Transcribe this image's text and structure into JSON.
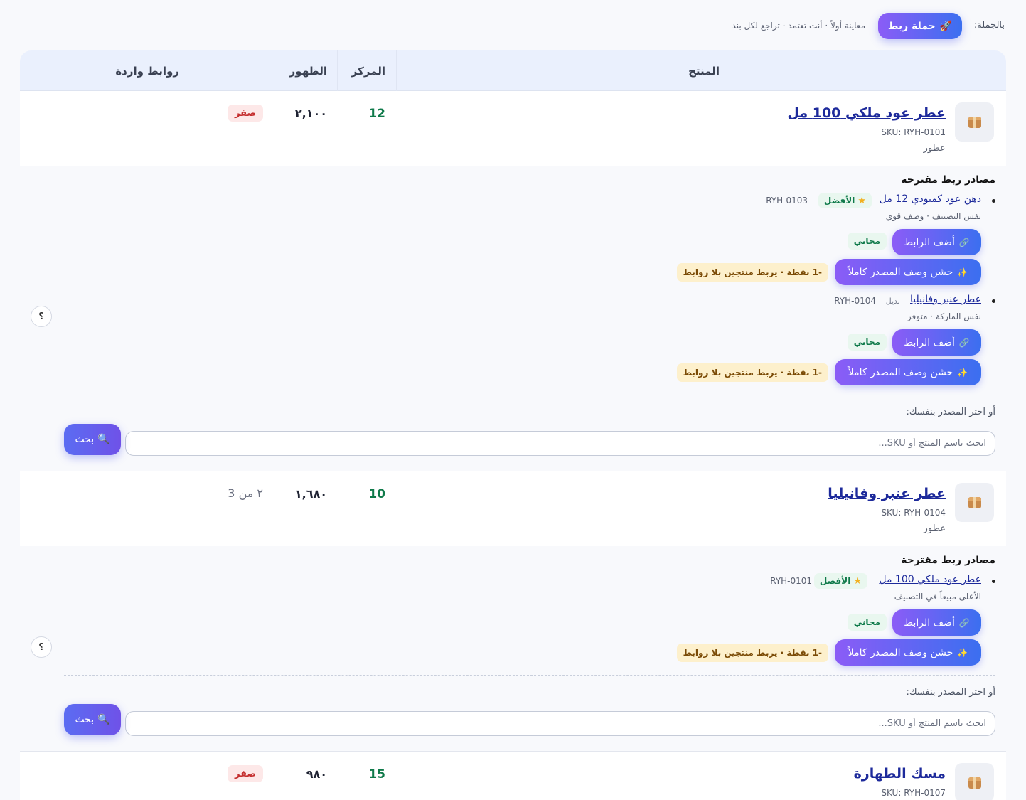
{
  "bulk": {
    "label": "بالجملة:",
    "campaign_button": "حملة ربط",
    "hint": "معاينة أولاً · أنت تعتمد · تراجع لكل بند"
  },
  "table": {
    "headers": {
      "product": "المنتج",
      "rank": "المركز",
      "views": "الظهور",
      "inbound": "روابط واردة"
    }
  },
  "rows": [
    {
      "name": "عطر عود ملكي 100 مل",
      "sku": "SKU: RYH-0101",
      "category": "عطور",
      "rank": "12",
      "views": "٢,١٠٠",
      "inbound": "صفر",
      "suggestions_title": "مصادر ربط مقترحة",
      "suggestions": [
        {
          "name": "دهن عود كمبودي 12 مل",
          "best": "الأفضل",
          "sku": "RYH-0103",
          "reason": "نفس التصنيف · وصف قوي",
          "add_label": "أضف الرابط",
          "free_label": "مجاني",
          "fill_label": "حشن وصف المصدر كاملاً",
          "cost_label": "-1 نقطة · يربط منتجين بلا روابط"
        },
        {
          "name": "عطر عنبر وفانيليا",
          "alt": "بديل",
          "sku": "RYH-0104",
          "reason": "نفس الماركة · متوفر",
          "add_label": "أضف الرابط",
          "free_label": "مجاني",
          "fill_label": "حشن وصف المصدر كاملاً",
          "cost_label": "-1 نقطة · يربط منتجين بلا روابط"
        }
      ],
      "help": "؟",
      "or_label": "أو اختر المصدر بنفسك:",
      "search_placeholder": "ابحث باسم المنتج أو SKU...",
      "search_button": "بحث"
    },
    {
      "name": "عطر عنبر وفانيليا",
      "sku": "SKU: RYH-0104",
      "category": "عطور",
      "rank": "10",
      "views": "١,٦٨٠",
      "inbound": "٢ من 3",
      "suggestions_title": "مصادر ربط مقترحة",
      "suggestions": [
        {
          "name": "عطر عود ملكي 100 مل",
          "best": "الأفضل",
          "sku": "RYH-0101",
          "reason": "الأعلى مبيعاً في التصنيف",
          "add_label": "أضف الرابط",
          "free_label": "مجاني",
          "fill_label": "حشن وصف المصدر كاملاً",
          "cost_label": "-1 نقطة · يربط منتجين بلا روابط"
        }
      ],
      "help": "؟",
      "or_label": "أو اختر المصدر بنفسك:",
      "search_placeholder": "ابحث باسم المنتج أو SKU...",
      "search_button": "بحث"
    },
    {
      "name": "مسك الطهارة",
      "sku": "SKU: RYH-0107",
      "rank": "15",
      "views": "٩٨٠",
      "inbound": "صفر"
    }
  ],
  "colors": {
    "accent_start": "#8b5cf6",
    "accent_end": "#3b6ff0",
    "rank_green": "#0f7a4a",
    "link_blue": "#1d2a9b",
    "zero_red": "#c53030"
  },
  "icons": {
    "campaign": "rocket-icon",
    "thumb": "package-icon",
    "add": "link-icon",
    "fill": "sparkles-icon",
    "search": "magnifier-icon",
    "best": "star-icon"
  }
}
